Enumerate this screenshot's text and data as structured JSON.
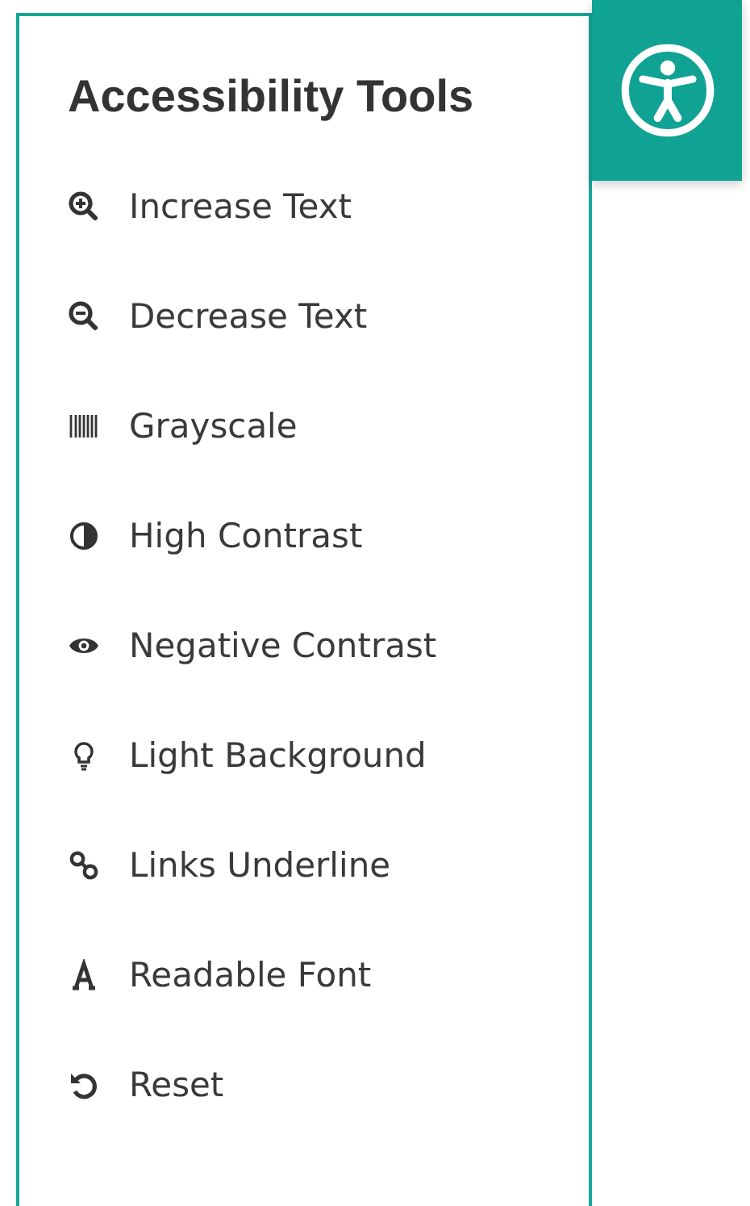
{
  "panel": {
    "title": "Accessibility Tools",
    "items": [
      {
        "kind": "zoom-in",
        "label": "Increase Text"
      },
      {
        "kind": "zoom-out",
        "label": "Decrease Text"
      },
      {
        "kind": "barcode",
        "label": "Grayscale"
      },
      {
        "kind": "contrast",
        "label": "High Contrast"
      },
      {
        "kind": "eye",
        "label": "Negative Contrast"
      },
      {
        "kind": "bulb",
        "label": "Light Background"
      },
      {
        "kind": "link",
        "label": "Links Underline"
      },
      {
        "kind": "font",
        "label": "Readable Font"
      },
      {
        "kind": "reset",
        "label": "Reset"
      }
    ]
  },
  "toggle": {
    "kind": "accessibility"
  }
}
